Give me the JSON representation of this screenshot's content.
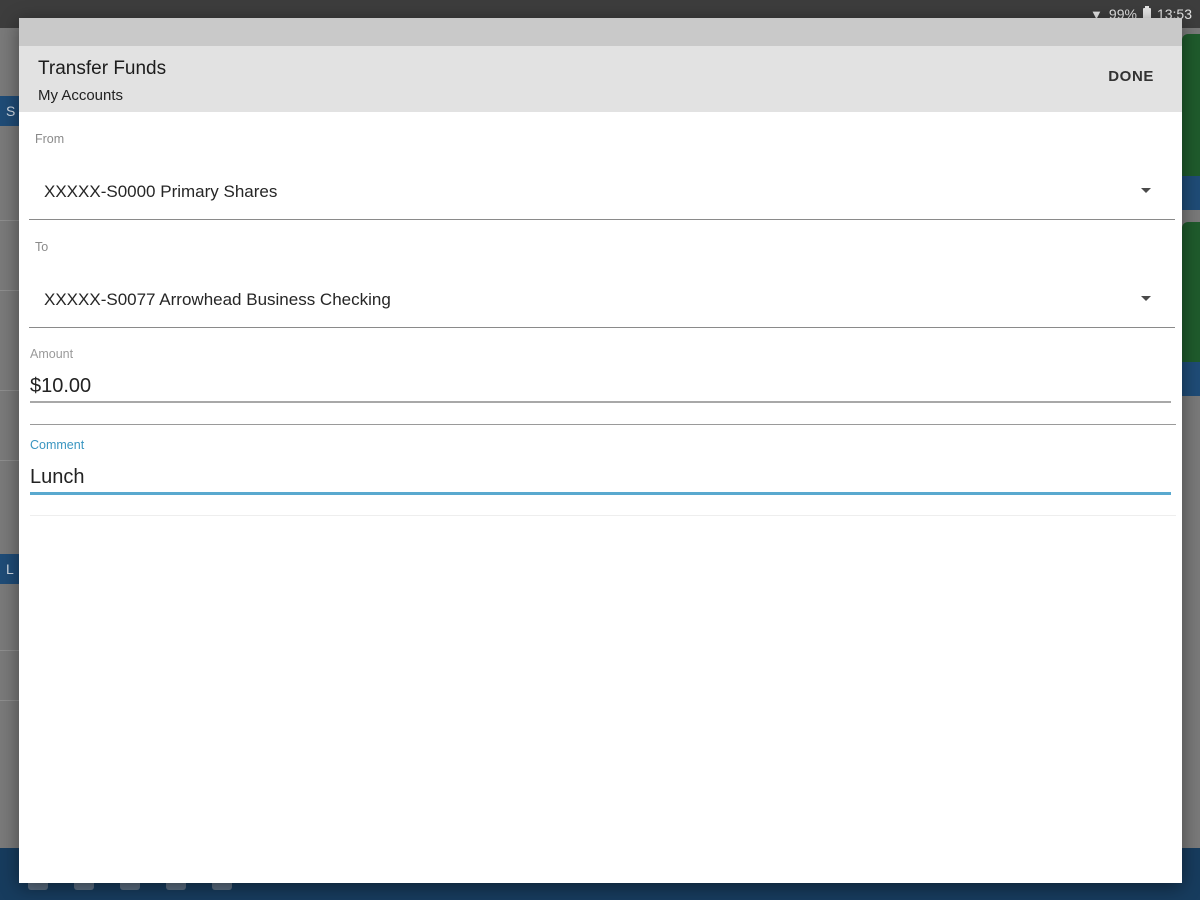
{
  "status_bar": {
    "battery": "99%",
    "time": "13:53"
  },
  "background_app": {
    "left_badges": [
      "S",
      "L"
    ]
  },
  "dialog": {
    "title": "Transfer Funds",
    "subtitle": "My Accounts",
    "done_label": "DONE",
    "from": {
      "label": "From",
      "value": "XXXXX-S0000 Primary Shares"
    },
    "to": {
      "label": "To",
      "value": "XXXXX-S0077 Arrowhead Business Checking"
    },
    "amount": {
      "label": "Amount",
      "value": "$10.00"
    },
    "comment": {
      "label": "Comment",
      "value": "Lunch"
    }
  },
  "colors": {
    "accent_focus": "#59a9cf",
    "header_bg": "#e2e2e2",
    "nav_bg": "#173c5e"
  }
}
